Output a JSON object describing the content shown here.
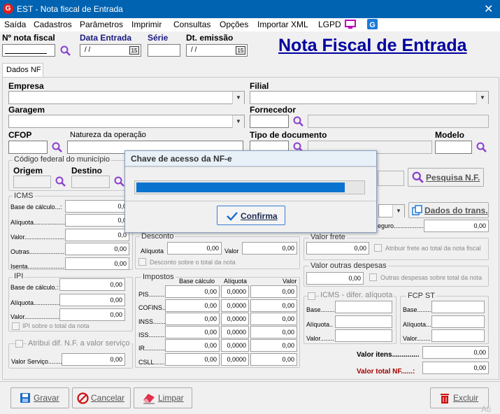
{
  "window": {
    "title": "EST - Nota fiscal de Entrada",
    "app_icon_letter": "G"
  },
  "menu": [
    "Saída",
    "Cadastros",
    "Parâmetros",
    "Imprimir",
    "Consultas",
    "Opções",
    "Importar XML",
    "LGPD"
  ],
  "header": {
    "nota_label": "Nº nota fiscal",
    "data_entrada_label": "Data Entrada",
    "data_entrada_value": " /  /",
    "serie_label": "Série",
    "dt_emissao_label": "Dt. emissão",
    "dt_emissao_value": " /  /",
    "calendar_text": "15",
    "big_title": "Nota Fiscal de Entrada"
  },
  "tab": "Dados NF",
  "fields": {
    "empresa": "Empresa",
    "filial": "Filial",
    "garagem": "Garagem",
    "fornecedor": "Fornecedor",
    "cfop": "CFOP",
    "natureza": "Natureza da operação",
    "tipo_doc": "Tipo de documento",
    "modelo": "Modelo",
    "cod_federal": "Código federal do município",
    "origem": "Origem",
    "destino": "Destino"
  },
  "buttons": {
    "pesquisa": "Pesquisa N.F.",
    "dados_trans": "Dados do trans.",
    "gravar": "Gravar",
    "cancelar": "Cancelar",
    "limpar": "Limpar",
    "excluir": "Excluir",
    "confirma": "Confirma"
  },
  "icms": {
    "title": "ICMS",
    "rows": [
      {
        "label": "Base de cálculo...:",
        "value": "0,0"
      },
      {
        "label": "Alíquota...................",
        "value": "0,0"
      },
      {
        "label": "Valor........................",
        "value": "0,0"
      },
      {
        "label": "Outras.......................",
        "value": "0,00"
      },
      {
        "label": "Isenta........................",
        "value": "0,00"
      }
    ]
  },
  "ipi": {
    "title": "IPI",
    "rows": [
      {
        "label": "Base de cálculo.:",
        "value": "0,00"
      },
      {
        "label": "Alíquota.................",
        "value": "0,00"
      },
      {
        "label": "Valor.....................",
        "value": "0,00"
      }
    ],
    "check": "IPI sobre o total da nota"
  },
  "atribui": {
    "check": "Atribui dif. N.F. a valor serviço",
    "valor_label": "Valor Serviço........",
    "valor": "0,00"
  },
  "desconto": {
    "title": "Desconto",
    "aliquota_label": "Alíquota",
    "aliquota": "0,00",
    "valor_label": "Valor",
    "valor": "0,00",
    "check": "Desconto sobre o total da nota"
  },
  "impostos": {
    "title": "Impostos",
    "col_base": "Base cálculo",
    "col_aliq": "Alíquota",
    "col_valor": "Valor",
    "rows": [
      {
        "label": "PIS..........",
        "base": "0,00",
        "aliq": "0,0000",
        "valor": "0,00"
      },
      {
        "label": "COFINS.......",
        "base": "0,00",
        "aliq": "0,0000",
        "valor": "0,00"
      },
      {
        "label": "INSS..........",
        "base": "0,00",
        "aliq": "0,0000",
        "valor": "0,00"
      },
      {
        "label": "ISS............",
        "base": "0,00",
        "aliq": "0,0000",
        "valor": "0,00"
      },
      {
        "label": "IR...............",
        "base": "0,00",
        "aliq": "0,0000",
        "valor": "0,00"
      },
      {
        "label": "CSLL..........",
        "base": "0,00",
        "aliq": "0,0000",
        "valor": "0,00"
      }
    ]
  },
  "seguro": {
    "label": "eguro.......................",
    "value": "0,00"
  },
  "frete": {
    "title": "Valor frete",
    "value": "0,00",
    "check": "Atribuir frete ao total da nota fiscal"
  },
  "outras": {
    "title": "Valor outras despesas",
    "value": "0,00",
    "check": "Outras despesas sobre total da nota"
  },
  "icms_dif": {
    "title": "ICMS - difer. alíquota",
    "base": "Base.........",
    "aliquota": "Alíquota..",
    "valor": "Valor........"
  },
  "fcp": {
    "title": "FCP ST",
    "base": "Base..........",
    "aliquota": "Alíquota...",
    "valor": "Valor........"
  },
  "totals": {
    "itens_label": "Valor itens..............",
    "itens": "0,00",
    "total_label": "Valor total NF......:",
    "total": "0,00"
  },
  "dialog": {
    "title": "Chave de acesso da NF-e",
    "progress": 0.92
  },
  "watermark": "Ati",
  "colors": {
    "titlebar": "#0063b1",
    "accent": "#0000a0",
    "progress": "#0a73d0",
    "red": "#a00000"
  }
}
